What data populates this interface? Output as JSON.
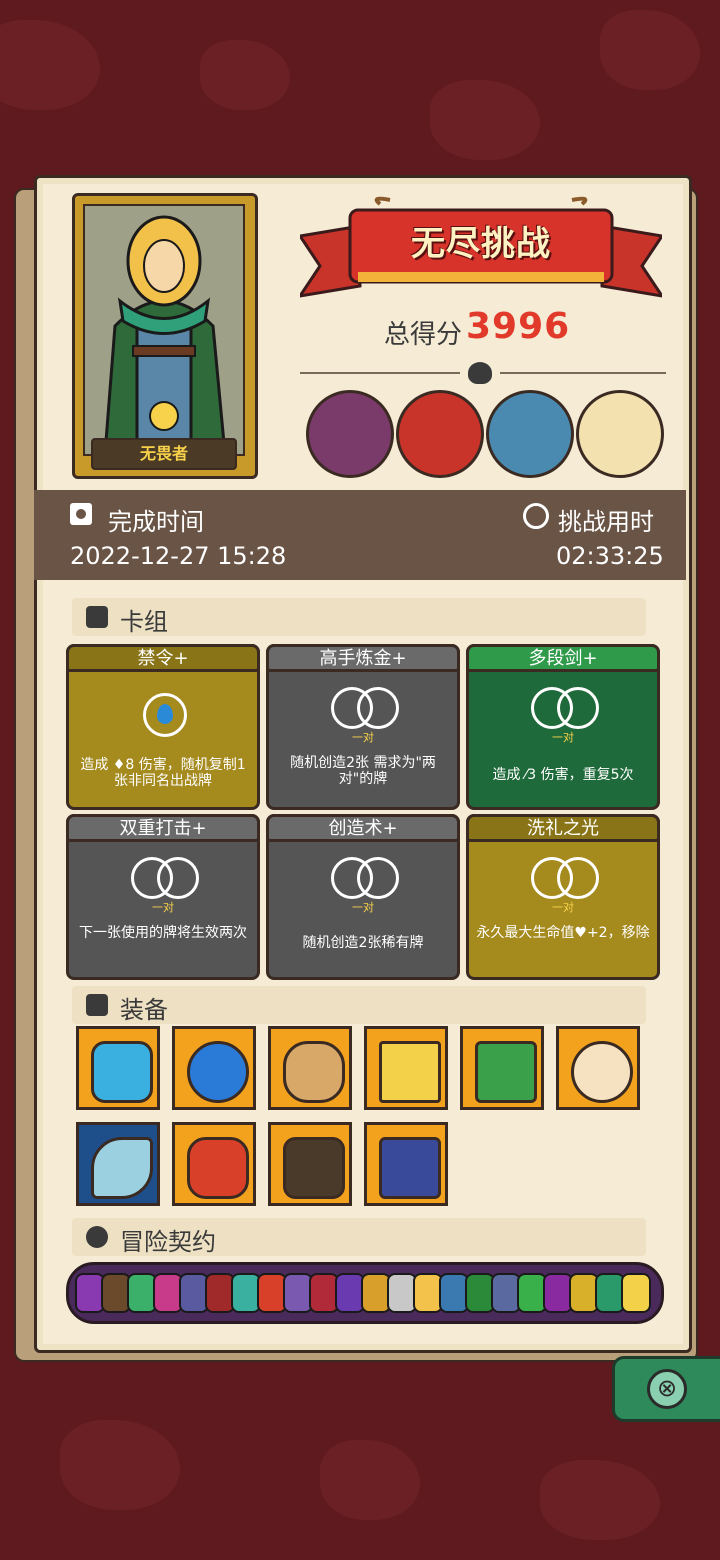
{
  "hero": {
    "name": "无畏者"
  },
  "banner": {
    "title": "无尽挑战"
  },
  "score": {
    "label": "总得分",
    "value": "3996"
  },
  "times": {
    "finish_label": "完成时间",
    "finish_value": "2022-12-27 15:28",
    "duration_label": "挑战用时",
    "duration_value": "02:33:25"
  },
  "deck": {
    "title": "卡组",
    "cards": [
      {
        "name": "禁令+",
        "tag": "",
        "desc": "造成 ♦8 伤害，随机复制1张非同名出战牌",
        "color": "#a58a1e"
      },
      {
        "name": "高手炼金+",
        "tag": "一对",
        "desc": "随机创造2张 需求为\"两对\"的牌",
        "color": "#555555"
      },
      {
        "name": "多段剑+",
        "tag": "一对",
        "desc": "造成 ⁄3 伤害，重复5次",
        "color": "#1f6a3a"
      },
      {
        "name": "双重打击+",
        "tag": "一对",
        "desc": "下一张使用的牌将生效两次",
        "color": "#555555"
      },
      {
        "name": "创造术+",
        "tag": "一对",
        "desc": "随机创造2张稀有牌",
        "color": "#555555"
      },
      {
        "name": "洗礼之光",
        "tag": "一对",
        "desc": "永久最大生命值♥+2，移除",
        "color": "#a58a1e"
      }
    ]
  },
  "equipment": {
    "title": "装备",
    "items": [
      "shield-icon",
      "mushroom-icon",
      "bag-icon",
      "crown-icon",
      "scroll-icon",
      "ring-icon",
      "axe-icon",
      "mask-icon",
      "cloak-icon",
      "hexagram-icon"
    ]
  },
  "contracts": {
    "title": "冒险契约"
  },
  "close": {
    "label": "⊗"
  }
}
